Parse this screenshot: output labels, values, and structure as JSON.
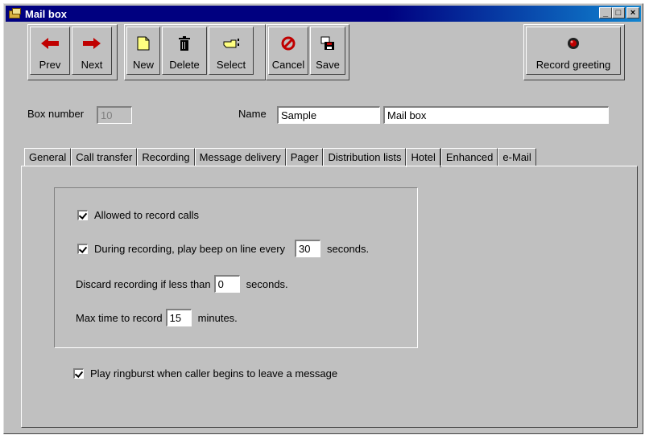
{
  "window": {
    "title": "Mail box",
    "controls": {
      "minimize": "_",
      "maximize": "□",
      "close": "×"
    }
  },
  "toolbar": {
    "prev": "Prev",
    "next": "Next",
    "new": "New",
    "delete": "Delete",
    "select": "Select",
    "cancel": "Cancel",
    "save": "Save",
    "record_greeting": "Record greeting"
  },
  "form": {
    "box_number_label": "Box number",
    "box_number_value": "10",
    "name_label": "Name",
    "first_name_value": "Sample",
    "last_name_value": "Mail box"
  },
  "tabs": [
    "General",
    "Call transfer",
    "Recording",
    "Message delivery",
    "Pager",
    "Distribution lists",
    "Hotel",
    "Enhanced",
    "e-Mail"
  ],
  "active_tab": "Hotel",
  "recording": {
    "allowed_label": "Allowed to record calls",
    "beep_label": "During recording, play beep on line every",
    "beep_value": "30",
    "beep_unit": "seconds.",
    "discard_label": "Discard recording if less than",
    "discard_value": "0",
    "discard_unit": "seconds.",
    "max_label": "Max time to record",
    "max_value": "15",
    "max_unit": "minutes.",
    "ringburst_label": "Play ringburst when caller begins to leave a message"
  }
}
